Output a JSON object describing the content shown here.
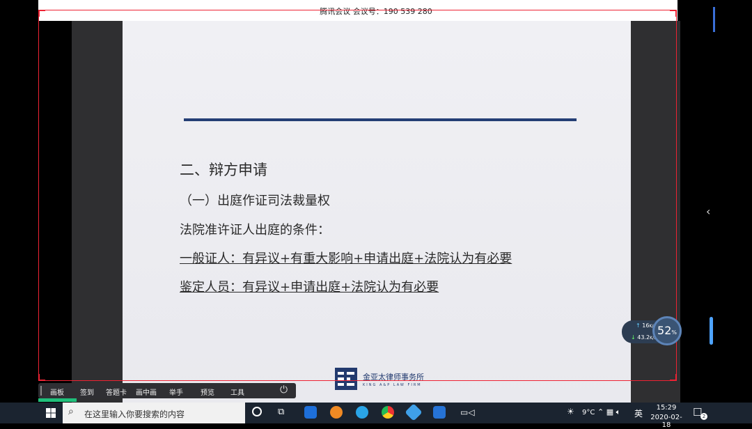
{
  "window": {
    "title": "腾讯会议 会议号：190 539 280",
    "restore_icon": "restore-icon",
    "close_icon": "close-icon"
  },
  "slide": {
    "heading": "二、辩方申请",
    "subheading": "（一）出庭作证司法裁量权",
    "conditions_label": "法院准许证人出庭的条件：",
    "line1": "一般证人：有异议+有重大影响+申请出庭+法院认为有必要",
    "line2": "鉴定人员：有异议+申请出庭+法院认为有必要",
    "logo_cn": "金亚太律师事务所",
    "logo_en": "KING A&P LAW FIRM",
    "rule_color": "#243e75"
  },
  "meeting_toolbar": {
    "items": [
      "画板",
      "签到",
      "答题卡",
      "画中画",
      "举手",
      "预览",
      "工具"
    ],
    "power_icon": "power-icon"
  },
  "network_monitor": {
    "upload": "16",
    "upload_unit": "K/s",
    "download": "43.2",
    "download_unit": "K/s",
    "percent": "52",
    "percent_unit": "%"
  },
  "taskbar": {
    "search_placeholder": "在这里输入你要搜索的内容",
    "temperature": "9°C",
    "language": "英",
    "time": "15:29",
    "date": "2020-02-18",
    "notification_count": "2"
  }
}
